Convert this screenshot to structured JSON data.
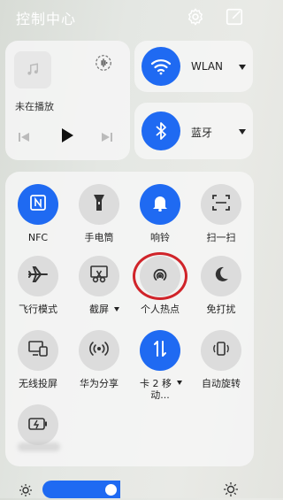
{
  "header": {
    "title": "控制中心"
  },
  "media": {
    "status": "未在播放"
  },
  "wlan": {
    "label": "WLAN"
  },
  "bluetooth": {
    "label": "蓝牙"
  },
  "tiles": [
    {
      "label": "NFC"
    },
    {
      "label": "手电筒"
    },
    {
      "label": "响铃"
    },
    {
      "label": "扫一扫"
    },
    {
      "label": "飞行模式"
    },
    {
      "label": "截屏"
    },
    {
      "label": "个人热点"
    },
    {
      "label": "免打扰"
    },
    {
      "label": "无线投屏"
    },
    {
      "label": "华为分享"
    },
    {
      "label": "卡 2 移",
      "label2": "动..."
    },
    {
      "label": "自动旋转"
    }
  ],
  "brightness": {
    "level_percent": 35
  },
  "colors": {
    "accent": "#1f6af2",
    "tile_off": "#dcdcdc",
    "annotation_red": "#d0242a"
  },
  "annotation": {
    "shape": "red circle",
    "target": "个人热点"
  }
}
